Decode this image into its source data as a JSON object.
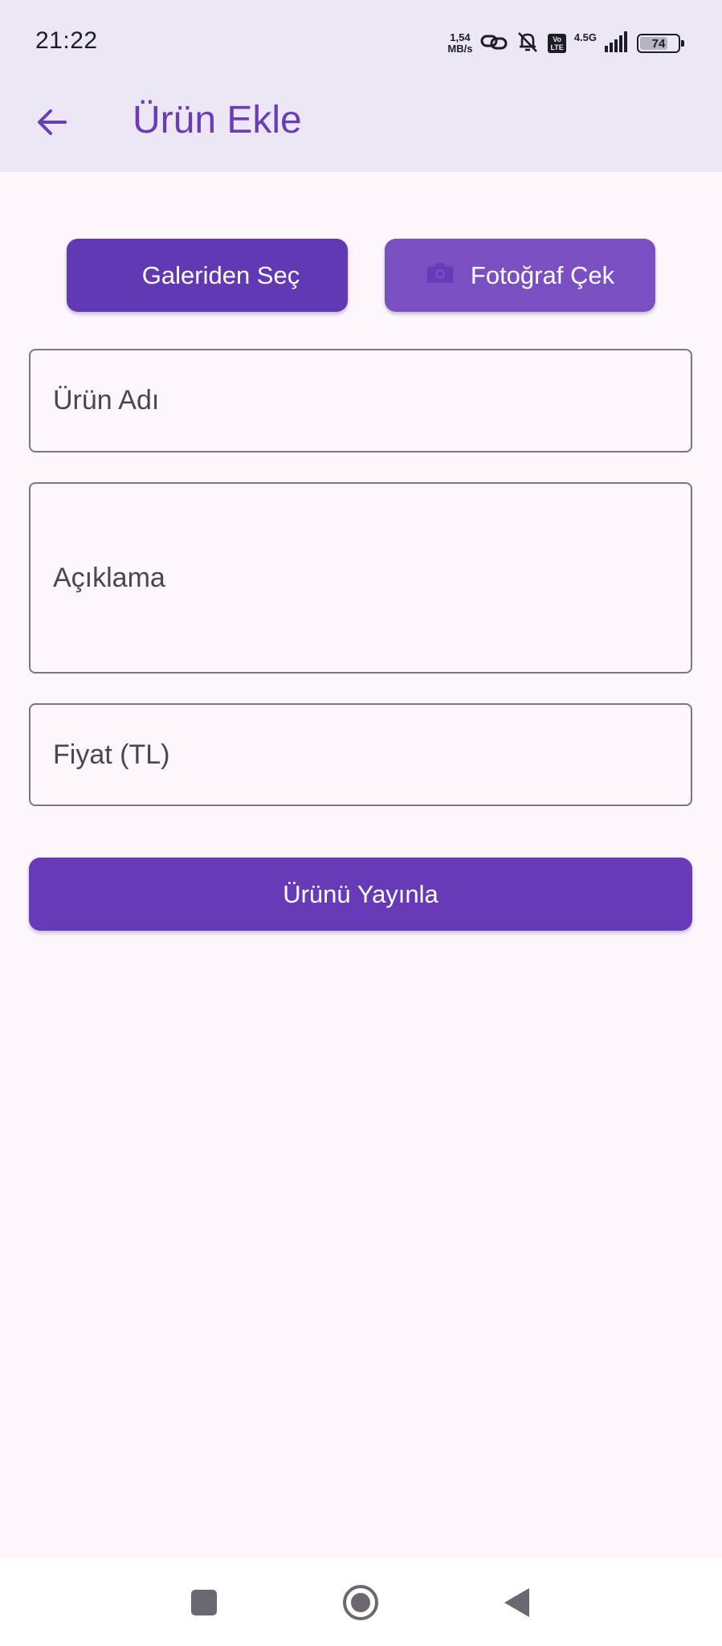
{
  "status_bar": {
    "time": "21:22",
    "net_speed_value": "1,54",
    "net_speed_unit": "MB/s",
    "volte_top": "Vo",
    "volte_bottom": "LTE",
    "network_type": "4.5G",
    "battery_level": "74",
    "battery_fraction": 0.74,
    "icons": [
      "link-icon",
      "bell-off-icon",
      "volte-icon",
      "signal-icon",
      "battery-icon"
    ]
  },
  "app_bar": {
    "back_icon": "arrow-left-icon",
    "title": "Ürün Ekle"
  },
  "media_buttons": {
    "gallery_label": "Galeriden Seç",
    "camera_label": "Fotoğraf Çek",
    "camera_icon": "camera-icon"
  },
  "form": {
    "name_label": "Ürün Adı",
    "description_label": "Açıklama",
    "price_label": "Fiyat (TL)"
  },
  "publish_button": {
    "label": "Ürünü Yayınla"
  },
  "nav_bar": {
    "icons": [
      "recents-icon",
      "home-icon",
      "back-icon"
    ]
  },
  "colors": {
    "header_background": "#ede6f5",
    "page_background": "#fdf7fd",
    "primary": "#673ab7",
    "title": "#6a3db8",
    "camera_button": "#7a4fc2",
    "field_border": "#7a757f"
  }
}
